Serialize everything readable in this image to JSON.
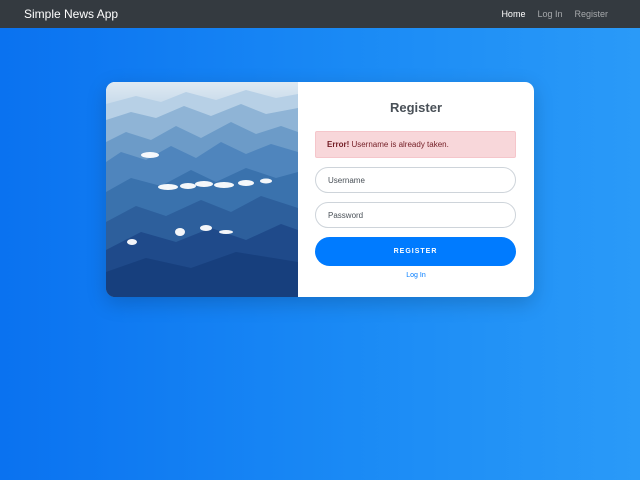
{
  "navbar": {
    "brand": "Simple News App",
    "links": [
      {
        "label": "Home",
        "active": true
      },
      {
        "label": "Log In",
        "active": false
      },
      {
        "label": "Register",
        "active": false
      }
    ]
  },
  "register_card": {
    "title": "Register",
    "alert": {
      "prefix": "Error!",
      "message": " Username is already taken."
    },
    "username": {
      "placeholder": "Username",
      "value": ""
    },
    "password": {
      "placeholder": "Password",
      "value": ""
    },
    "submit_label": "REGISTER",
    "login_link": "Log In"
  },
  "colors": {
    "navbar_bg": "#343a40",
    "primary": "#007bff",
    "alert_bg": "#f8d7da",
    "alert_text": "#721c24"
  },
  "icons": {
    "card_image": "mountain-landscape-image"
  }
}
